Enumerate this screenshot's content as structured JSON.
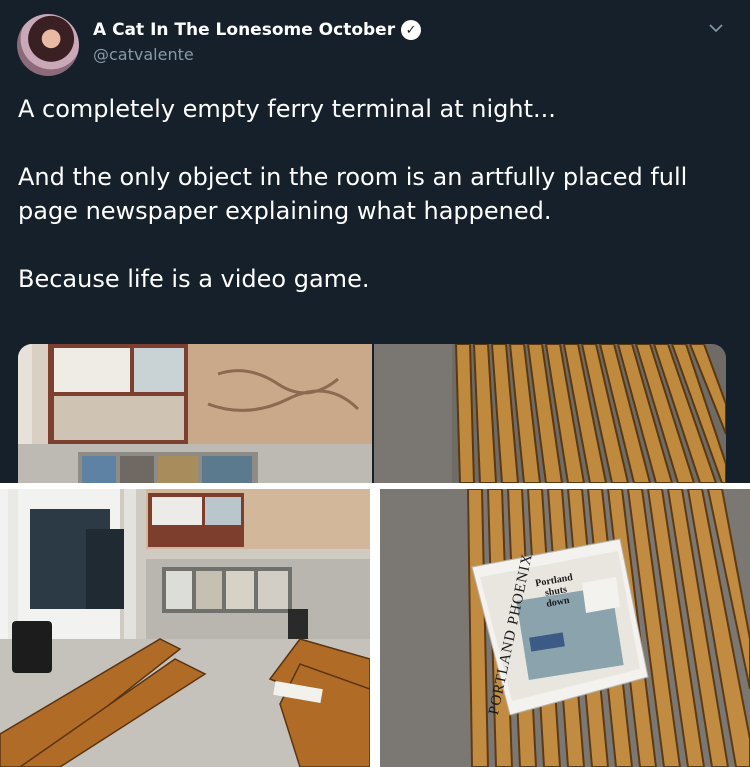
{
  "tweet": {
    "display_name": "A Cat In The Lonesome October",
    "handle": "@catvalente",
    "paragraphs": [
      "A completely empty ferry terminal at night...",
      "And the only object in the room is an artfully placed full page newspaper explaining what happened.",
      "Because life is a video game."
    ],
    "icons": {
      "verified": "verified-badge-icon",
      "menu": "chevron-down-icon"
    }
  },
  "media": {
    "newspaper": {
      "masthead": "PORTLAND PHOENIX",
      "headline_line1": "Portland",
      "headline_line2": "shuts",
      "headline_line3": "down"
    }
  },
  "colors": {
    "background": "#15202b",
    "text": "#ffffff",
    "secondary_text": "#8899a6",
    "bench_wood": "#b07a33"
  }
}
